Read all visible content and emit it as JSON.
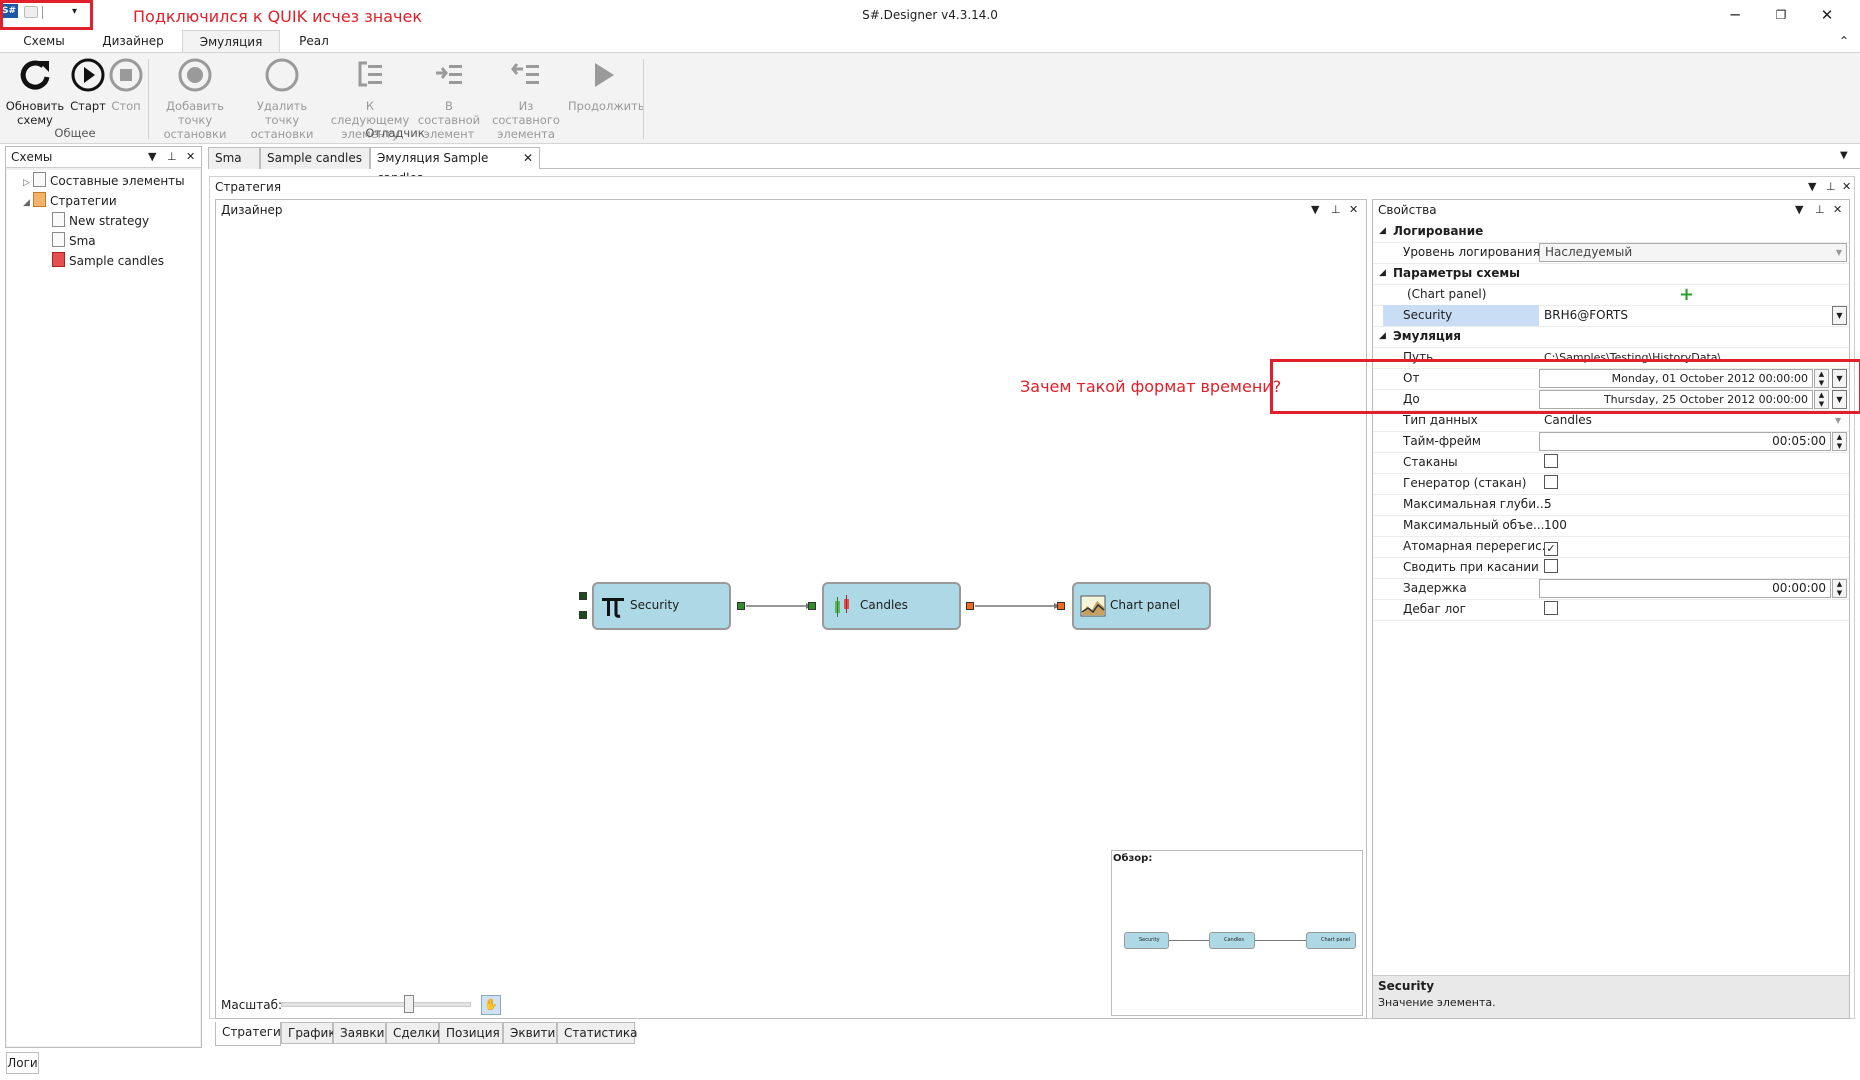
{
  "window": {
    "title": "S#.Designer v4.3.14.0",
    "logo": "S#",
    "qat_menu": "▾",
    "minimize": "─",
    "maximize": "❐",
    "close": "✕"
  },
  "annotations": {
    "top": "Подключился к QUIK исчез значек",
    "middle": "Зачем такой формат времени?",
    "color": "#e0202a"
  },
  "ribbon": {
    "tabs": [
      "Схемы",
      "Дизайнер",
      "Эмуляция",
      "Реал"
    ],
    "active_tab": "Эмуляция",
    "collapse": "⌃",
    "buttons": {
      "refresh": [
        "Обновить",
        "схему"
      ],
      "start": "Старт",
      "stop": "Стоп",
      "add_bp": [
        "Добавить точку",
        "остановки"
      ],
      "remove_bp": [
        "Удалить точку",
        "остановки"
      ],
      "next": [
        "К следующему",
        "элементу"
      ],
      "into": [
        "В составной",
        "элемент"
      ],
      "out": [
        "Из составного",
        "элемента"
      ],
      "continue": "Продолжить"
    },
    "groups": {
      "general": "Общее",
      "debugger": "Отладчик"
    }
  },
  "left_panel": {
    "title": "Схемы",
    "tree": [
      {
        "label": "Составные элементы",
        "expander": "▷"
      },
      {
        "label": "Стратегии",
        "expander": "◢"
      },
      {
        "label": "New strategy"
      },
      {
        "label": "Sma"
      },
      {
        "label": "Sample candles"
      }
    ]
  },
  "doc_tabs": [
    "Sma",
    "Sample candles",
    "Эмуляция Sample candles"
  ],
  "doc_tab_close": "✕",
  "strategy": {
    "title": "Стратегия",
    "designer_title": "Дизайнер",
    "scale_label": "Масштаб:",
    "overview_label": "Обзор:"
  },
  "nodes": [
    "Security",
    "Candles",
    "Chart panel"
  ],
  "properties": {
    "title": "Свойства",
    "rows": [
      {
        "type": "cat",
        "name": "Логирование"
      },
      {
        "name": "Уровень логирования",
        "value": "Наследуемый"
      },
      {
        "type": "cat",
        "name": "Параметры схемы"
      },
      {
        "name": "(Chart panel)",
        "value": "+"
      },
      {
        "name": "Security",
        "value": "BRH6@FORTS"
      },
      {
        "type": "cat",
        "name": "Эмуляция"
      },
      {
        "name": "Путь",
        "value": "C:\\Samples\\Testing\\HistoryData\\"
      },
      {
        "name": "От",
        "value": "Monday, 01 October 2012 00:00:00"
      },
      {
        "name": "До",
        "value": "Thursday, 25 October 2012 00:00:00"
      },
      {
        "name": "Тип данных",
        "value": "Candles"
      },
      {
        "name": "Тайм-фрейм",
        "value": "00:05:00"
      },
      {
        "name": "Стаканы",
        "value": ""
      },
      {
        "name": "Генератор (стакан)",
        "value": ""
      },
      {
        "name": "Максимальная глуби...",
        "value": "5"
      },
      {
        "name": "Максимальный объе...",
        "value": "100"
      },
      {
        "name": "Атомарная перерегис...",
        "value": "✓"
      },
      {
        "name": "Сводить при касании",
        "value": ""
      },
      {
        "name": "Задержка",
        "value": "00:00:00"
      },
      {
        "name": "Дебаг лог",
        "value": ""
      }
    ],
    "desc_title": "Security",
    "desc_text": "Значение элемента."
  },
  "bottom_tabs": [
    "Стратегия",
    "График",
    "Заявки",
    "Сделки",
    "Позиция",
    "Эквити",
    "Статистика"
  ],
  "status": {
    "logs": "Логи"
  }
}
